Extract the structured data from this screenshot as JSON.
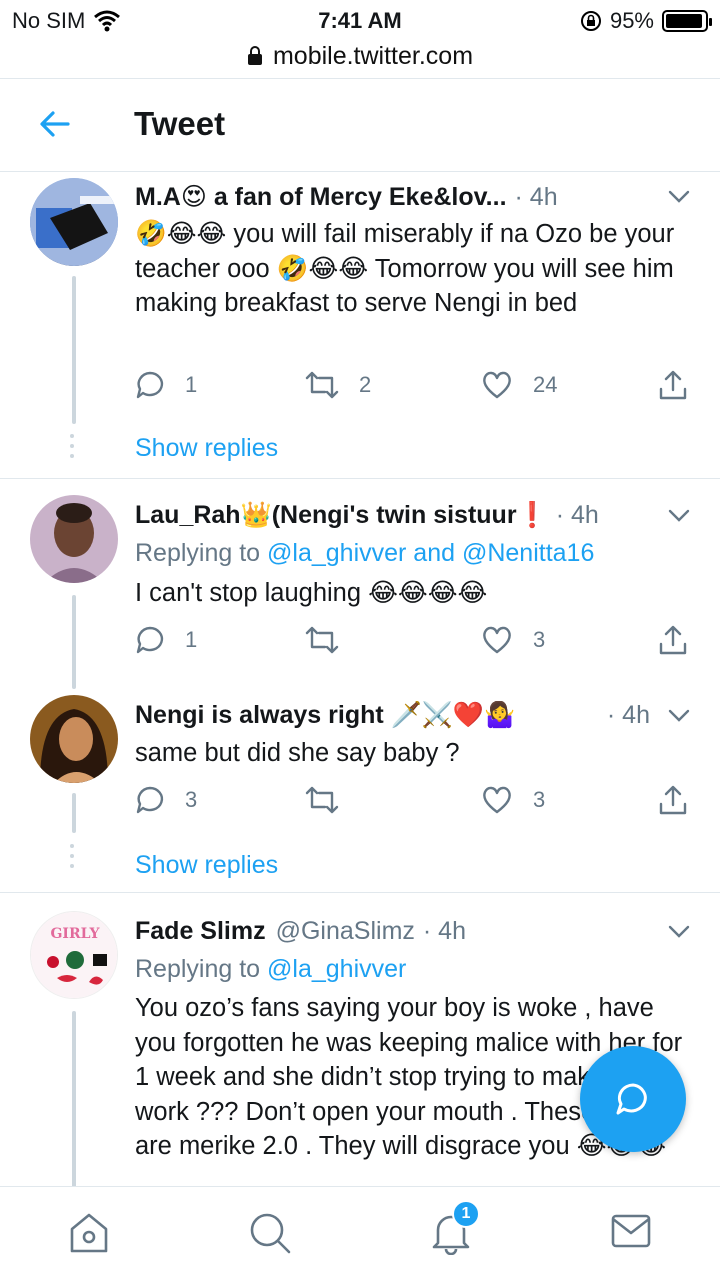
{
  "status": {
    "carrier": "No SIM",
    "time": "7:41 AM",
    "battery": "95%",
    "battery_level": 0.95
  },
  "browser": {
    "url": "mobile.twitter.com"
  },
  "header": {
    "title": "Tweet"
  },
  "tweets": [
    {
      "name": "M.A😍 a fan of Mercy Eke&lov...",
      "time": "· 4h",
      "body": "🤣😂😂 you will fail miserably if na Ozo be your teacher ooo 🤣😂😂 Tomorrow you will see him making breakfast to serve Nengi in bed",
      "replies": "1",
      "retweets": "2",
      "likes": "24",
      "show_replies": "Show replies"
    },
    {
      "name": "Lau_Rah👑(Nengi's twin sistuur❗",
      "time": "· 4h",
      "reply_prefix": "Replying to",
      "reply_to": "@la_ghivver and @Nenitta16",
      "body": "I can't stop laughing 😂😂😂😂",
      "replies": "1",
      "retweets": "",
      "likes": "3"
    },
    {
      "name": "Nengi is always right 🗡️⚔️❤️🤷‍♀️",
      "time": "· 4h",
      "body": "same but did she say baby ?",
      "replies": "3",
      "retweets": "",
      "likes": "3",
      "show_replies": "Show replies"
    },
    {
      "name": "Fade Slimz",
      "handle": "@GinaSlimz",
      "time": "· 4h",
      "reply_prefix": "Replying to",
      "reply_to": "@la_ghivver",
      "body": "You ozo’s fans saying your boy is woke , have you forgotten he was keeping malice with her for 1 week and she didn’t stop trying to make things work ??? Don’t open your mouth . These ones are merike 2.0 . They will disgrace you 😂😂😂"
    }
  ],
  "avatar_text": {
    "girly": "GIRLY"
  },
  "tabbar": {
    "notifications_badge": "1"
  },
  "icons": {
    "wifi": "wifi-icon",
    "lock": "lock-icon",
    "back": "back-arrow-icon",
    "reply": "reply-icon",
    "retweet": "retweet-icon",
    "like": "heart-icon",
    "share": "share-icon",
    "chevron": "chevron-down-icon",
    "compose": "compose-reply-icon",
    "home": "home-icon",
    "search": "search-icon",
    "notifications": "bell-icon",
    "messages": "mail-icon"
  },
  "colors": {
    "accent": "#1da1f2",
    "muted": "#657786",
    "text": "#14171a",
    "divider": "#e1e8ed"
  }
}
